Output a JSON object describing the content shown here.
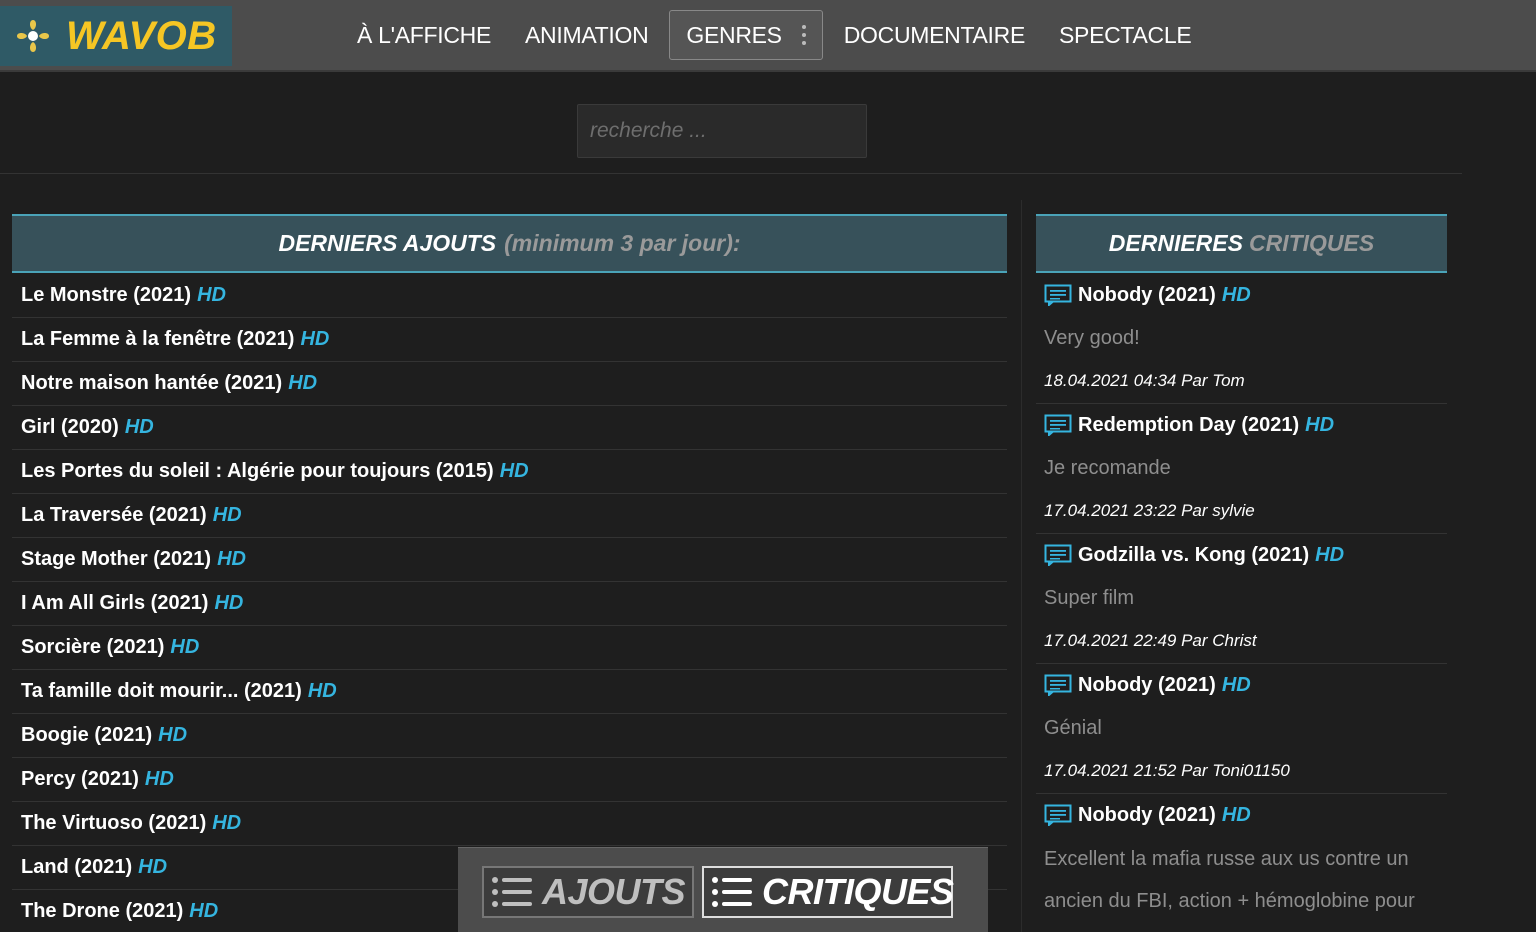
{
  "header": {
    "logo_text": "WAVOB",
    "nav": {
      "affiche": "À L'AFFICHE",
      "animation": "ANIMATION",
      "genres": "GENRES",
      "documentaire": "DOCUMENTAIRE",
      "spectacle": "SPECTACLE"
    }
  },
  "search": {
    "placeholder": "recherche ..."
  },
  "ajouts": {
    "heading_main": "DERNIERS AJOUTS",
    "heading_sub": "(minimum 3 par jour):",
    "items": [
      {
        "title": "Le Monstre (2021)",
        "quality": "HD"
      },
      {
        "title": "La Femme à la fenêtre (2021)",
        "quality": "HD"
      },
      {
        "title": "Notre maison hantée (2021)",
        "quality": "HD"
      },
      {
        "title": "Girl (2020)",
        "quality": "HD"
      },
      {
        "title": "Les Portes du soleil : Algérie pour toujours (2015)",
        "quality": "HD"
      },
      {
        "title": "La Traversée (2021)",
        "quality": "HD"
      },
      {
        "title": "Stage Mother (2021)",
        "quality": "HD"
      },
      {
        "title": "I Am All Girls (2021)",
        "quality": "HD"
      },
      {
        "title": "Sorcière (2021)",
        "quality": "HD"
      },
      {
        "title": "Ta famille doit mourir... (2021)",
        "quality": "HD"
      },
      {
        "title": "Boogie (2021)",
        "quality": "HD"
      },
      {
        "title": "Percy (2021)",
        "quality": "HD"
      },
      {
        "title": "The Virtuoso (2021)",
        "quality": "HD"
      },
      {
        "title": "Land (2021)",
        "quality": "HD"
      },
      {
        "title": "The Drone (2021)",
        "quality": "HD"
      }
    ]
  },
  "critiques": {
    "heading_main": "DERNIERES",
    "heading_sub": "CRITIQUES",
    "items": [
      {
        "title": "Nobody (2021)",
        "quality": "HD",
        "text": "Very good!",
        "meta": "18.04.2021 04:34 Par Tom"
      },
      {
        "title": "Redemption Day (2021)",
        "quality": "HD",
        "text": "Je recomande",
        "meta": "17.04.2021 23:22 Par sylvie"
      },
      {
        "title": "Godzilla vs. Kong (2021)",
        "quality": "HD",
        "text": "Super film",
        "meta": "17.04.2021 22:49 Par Christ"
      },
      {
        "title": "Nobody (2021)",
        "quality": "HD",
        "text": "Génial",
        "meta": "17.04.2021 21:52 Par Toni01150"
      },
      {
        "title": "Nobody (2021)",
        "quality": "HD",
        "text": "Excellent la mafia russe aux us contre un ancien du FBI, action + hémoglobine pour"
      }
    ]
  },
  "floating_bar": {
    "ajouts_label": "AJOUTS",
    "critiques_label": "CRITIQUES"
  },
  "colors": {
    "accent": "#35b5e0",
    "logo_text": "#f6c624",
    "panel_head": "#37515a"
  }
}
